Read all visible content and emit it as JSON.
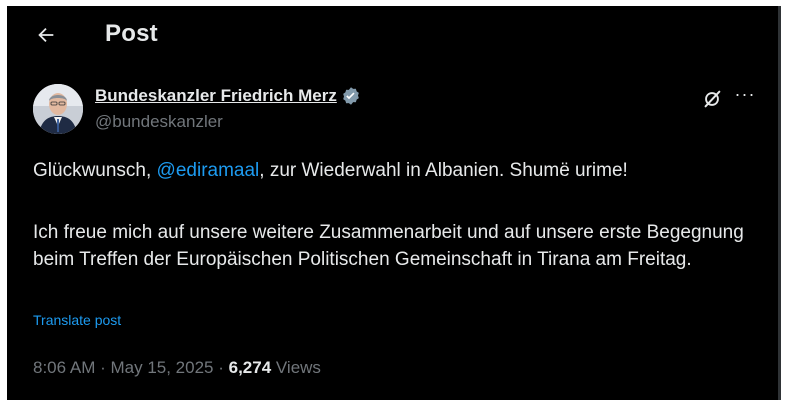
{
  "header": {
    "back_icon": "arrow-left-icon",
    "title": "Post"
  },
  "author": {
    "display_name": "Bundeskanzler Friedrich Merz",
    "handle": "@bundeskanzler",
    "verified_icon": "verified-badge-icon",
    "verified_color": "#829aab"
  },
  "actions": {
    "grok_icon": "grok-icon",
    "more_icon": "more-horizontal-icon",
    "more_label": "···"
  },
  "post": {
    "p1_before": "Glückwunsch, ",
    "p1_mention": "@ediramaal",
    "p1_after": ", zur Wiederwahl in Albanien. Shumë urime!",
    "p2": "Ich freue mich auf unsere weitere Zusammenarbeit und auf unsere erste Begegnung beim Treffen der Europäischen Politischen Gemeinschaft in Tirana am Freitag.",
    "translate_label": "Translate post"
  },
  "meta": {
    "time": "8:06 AM",
    "separator": " · ",
    "date": "May 15, 2025",
    "views_count": "6,274",
    "views_label": " Views"
  },
  "colors": {
    "background": "#000000",
    "text_primary": "#e7e9ea",
    "text_secondary": "#71767b",
    "link": "#1d9bf0"
  }
}
